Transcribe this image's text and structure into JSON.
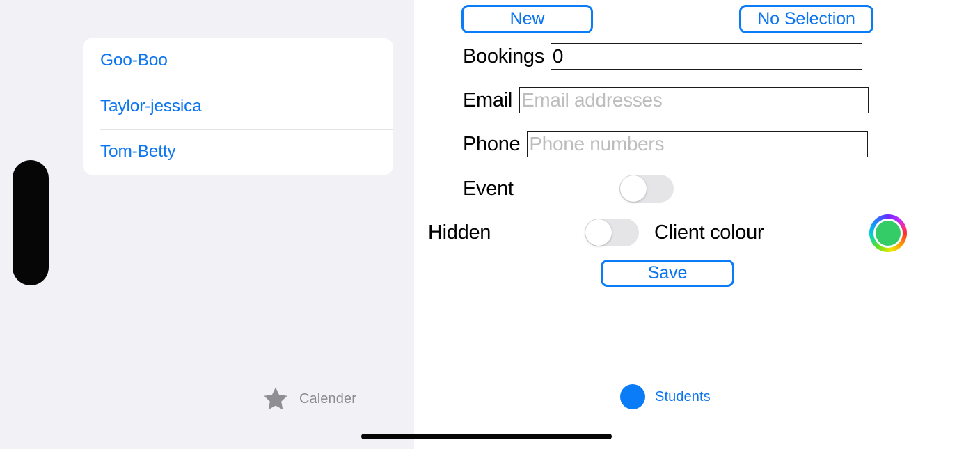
{
  "theme": {
    "accent_blue": "#0b74f0",
    "border_blue": "#0b7cf7",
    "left_pane_bg": "#f2f1f6",
    "right_pane_bg": "#ffffff",
    "toggle_off_track": "#e5e5e7",
    "client_colour_value": "#33cc66",
    "inactive_tab_grey": "#8a8a8f"
  },
  "sidebar": {
    "items": [
      {
        "label": "Goo-Boo"
      },
      {
        "label": "Taylor-jessica"
      },
      {
        "label": "Tom-Betty"
      }
    ],
    "tab": {
      "icon": "star-icon",
      "label": "Calender",
      "selected": false
    }
  },
  "detail": {
    "toolbar": {
      "new_label": "New",
      "selection_label": "No Selection"
    },
    "fields": {
      "bookings": {
        "label": "Bookings",
        "value": "0",
        "placeholder": ""
      },
      "email": {
        "label": "Email",
        "value": "",
        "placeholder": "Email addresses"
      },
      "phone": {
        "label": "Phone",
        "value": "",
        "placeholder": "Phone numbers"
      }
    },
    "toggles": {
      "event": {
        "label": "Event",
        "state": "off"
      },
      "hidden": {
        "label": "Hidden",
        "state": "off"
      }
    },
    "client_colour": {
      "label": "Client colour",
      "swatch_icon": "colour-wheel-icon",
      "value": "#33cc66"
    },
    "save_label": "Save",
    "tab": {
      "icon": "circle-icon",
      "label": "Students",
      "selected": true
    }
  }
}
